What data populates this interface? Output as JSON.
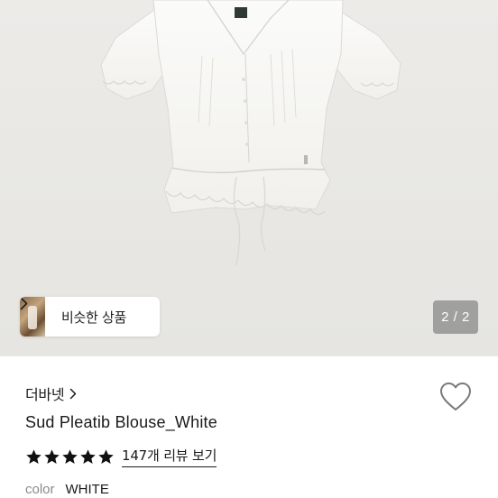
{
  "gallery": {
    "counter_text": "2 / 2",
    "product_image_alt": "white short sleeve blouse with drawstring hem",
    "background_color": "#e9e8e4"
  },
  "similar_products": {
    "label": "비슷한 상품",
    "chevron_icon": "chevron-right-icon"
  },
  "product": {
    "brand": "더바넷",
    "brand_chevron_icon": "chevron-right-icon",
    "title": "Sud Pleatib Blouse_White",
    "rating_stars": 5,
    "review_link_text": "147개 리뷰 보기",
    "color_label": "color",
    "color_value": "WHITE",
    "wishlist_icon": "heart-outline-icon"
  },
  "colors": {
    "text_primary": "#1a1a1a",
    "text_muted": "#8a8a8a",
    "counter_bg": "#8c8c8c"
  }
}
